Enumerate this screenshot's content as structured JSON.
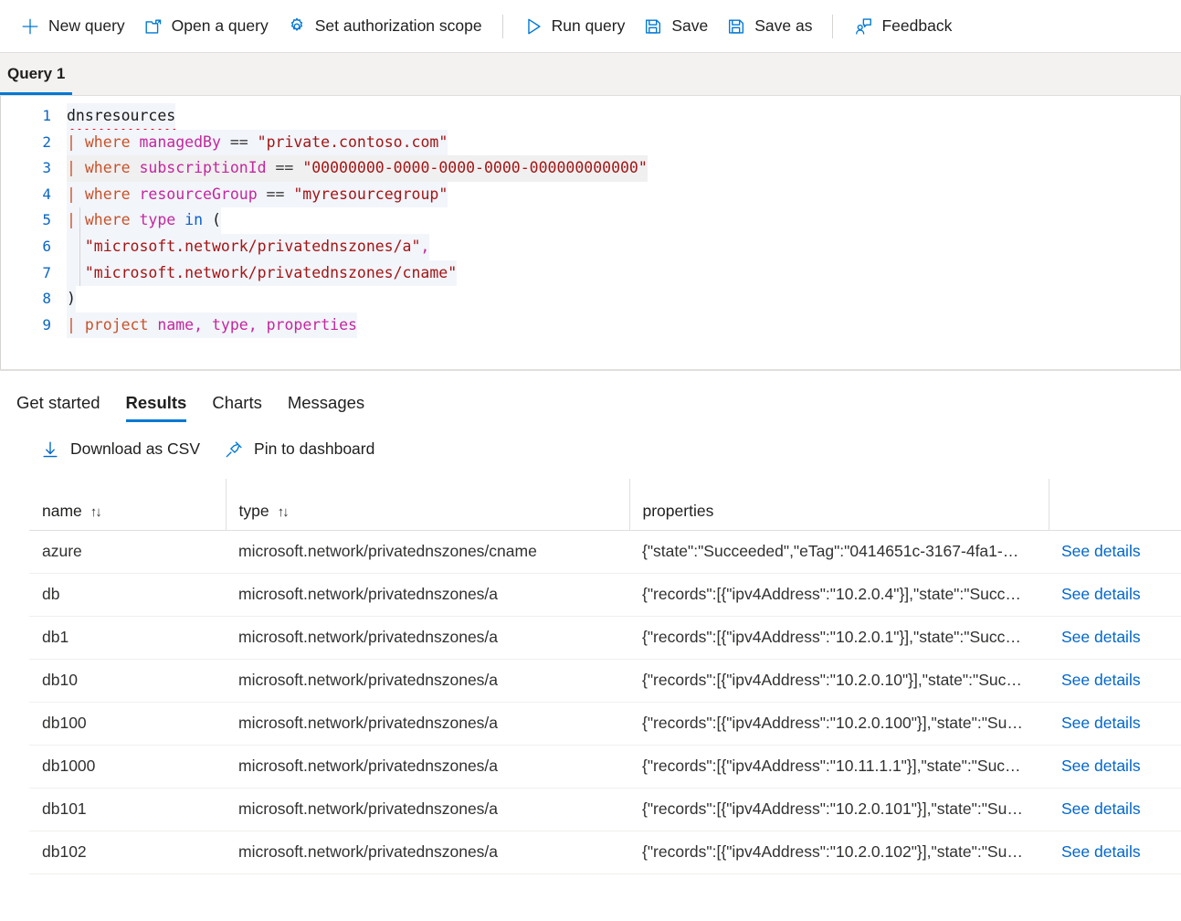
{
  "commandbar": {
    "items": [
      {
        "icon": "plus-icon",
        "label": "New query"
      },
      {
        "icon": "folder-open-icon",
        "label": "Open a query"
      },
      {
        "icon": "gear-icon",
        "label": "Set authorization scope"
      },
      {
        "icon": "play-icon",
        "label": "Run query"
      },
      {
        "icon": "save-icon",
        "label": "Save"
      },
      {
        "icon": "save-as-icon",
        "label": "Save as"
      },
      {
        "icon": "feedback-icon",
        "label": "Feedback"
      }
    ]
  },
  "query_tabs": {
    "tabs": [
      {
        "label": "Query 1",
        "active": true
      }
    ]
  },
  "editor": {
    "current_line": 3,
    "lines": [
      {
        "num": "1",
        "tokens": [
          {
            "t": "dnsresources",
            "c": "t-tbl",
            "squiggle": true
          }
        ]
      },
      {
        "num": "2",
        "tokens": [
          {
            "t": "| ",
            "c": "t-pipe"
          },
          {
            "t": "where ",
            "c": "t-kw"
          },
          {
            "t": "managedBy",
            "c": "t-col"
          },
          {
            "t": " == ",
            "c": "t-eq"
          },
          {
            "t": "\"private.contoso.com\"",
            "c": "t-str"
          }
        ]
      },
      {
        "num": "3",
        "tokens": [
          {
            "t": "| ",
            "c": "t-pipe"
          },
          {
            "t": "where ",
            "c": "t-kw"
          },
          {
            "t": "subscriptionId",
            "c": "t-col"
          },
          {
            "t": " == ",
            "c": "t-eq"
          },
          {
            "t": "\"00000000-0000-0000-0000-000000000000\"",
            "c": "t-str"
          }
        ]
      },
      {
        "num": "4",
        "tokens": [
          {
            "t": "| ",
            "c": "t-pipe"
          },
          {
            "t": "where ",
            "c": "t-kw"
          },
          {
            "t": "resourceGroup",
            "c": "t-col"
          },
          {
            "t": " == ",
            "c": "t-eq"
          },
          {
            "t": "\"myresourcegroup\"",
            "c": "t-str"
          }
        ]
      },
      {
        "num": "5",
        "tokens": [
          {
            "t": "| ",
            "c": "t-pipe"
          },
          {
            "t": "where ",
            "c": "t-kw"
          },
          {
            "t": "type",
            "c": "t-col"
          },
          {
            "t": " ",
            "c": "t-eq"
          },
          {
            "t": "in",
            "c": "t-op-in"
          },
          {
            "t": " (",
            "c": "t-paren"
          }
        ]
      },
      {
        "num": "6",
        "indent": 2,
        "tokens": [
          {
            "t": "  \"microsoft.network/privatednszones/a\"",
            "c": "t-str"
          },
          {
            "t": ",",
            "c": "t-comma"
          }
        ]
      },
      {
        "num": "7",
        "indent": 2,
        "tokens": [
          {
            "t": "  \"microsoft.network/privatednszones/cname\"",
            "c": "t-str"
          }
        ]
      },
      {
        "num": "8",
        "tokens": [
          {
            "t": ")",
            "c": "t-paren"
          }
        ]
      },
      {
        "num": "9",
        "tokens": [
          {
            "t": "| ",
            "c": "t-pipe"
          },
          {
            "t": "project ",
            "c": "t-kw"
          },
          {
            "t": "name",
            "c": "t-col"
          },
          {
            "t": ", ",
            "c": "t-comma"
          },
          {
            "t": "type",
            "c": "t-col"
          },
          {
            "t": ", ",
            "c": "t-comma"
          },
          {
            "t": "properties",
            "c": "t-col"
          }
        ]
      }
    ]
  },
  "results": {
    "tabs": [
      {
        "label": "Get started",
        "active": false
      },
      {
        "label": "Results",
        "active": true
      },
      {
        "label": "Charts",
        "active": false
      },
      {
        "label": "Messages",
        "active": false
      }
    ],
    "actions": [
      {
        "icon": "download-icon",
        "label": "Download as CSV"
      },
      {
        "icon": "pin-icon",
        "label": "Pin to dashboard"
      }
    ],
    "columns": [
      {
        "label": "name",
        "sortable": true
      },
      {
        "label": "type",
        "sortable": true
      },
      {
        "label": "properties",
        "sortable": false
      },
      {
        "label": "",
        "sortable": false
      }
    ],
    "sort_glyph": "↑↓",
    "details_label": "See details",
    "rows": [
      {
        "name": "azure",
        "type": "microsoft.network/privatednszones/cname",
        "properties": "{\"state\":\"Succeeded\",\"eTag\":\"0414651c-3167-4fa1-…"
      },
      {
        "name": "db",
        "type": "microsoft.network/privatednszones/a",
        "properties": "{\"records\":[{\"ipv4Address\":\"10.2.0.4\"}],\"state\":\"Succ…"
      },
      {
        "name": "db1",
        "type": "microsoft.network/privatednszones/a",
        "properties": "{\"records\":[{\"ipv4Address\":\"10.2.0.1\"}],\"state\":\"Succ…"
      },
      {
        "name": "db10",
        "type": "microsoft.network/privatednszones/a",
        "properties": "{\"records\":[{\"ipv4Address\":\"10.2.0.10\"}],\"state\":\"Suc…"
      },
      {
        "name": "db100",
        "type": "microsoft.network/privatednszones/a",
        "properties": "{\"records\":[{\"ipv4Address\":\"10.2.0.100\"}],\"state\":\"Su…"
      },
      {
        "name": "db1000",
        "type": "microsoft.network/privatednszones/a",
        "properties": "{\"records\":[{\"ipv4Address\":\"10.11.1.1\"}],\"state\":\"Suc…"
      },
      {
        "name": "db101",
        "type": "microsoft.network/privatednszones/a",
        "properties": "{\"records\":[{\"ipv4Address\":\"10.2.0.101\"}],\"state\":\"Su…"
      },
      {
        "name": "db102",
        "type": "microsoft.network/privatednszones/a",
        "properties": "{\"records\":[{\"ipv4Address\":\"10.2.0.102\"}],\"state\":\"Su…"
      }
    ]
  },
  "colors": {
    "accent": "#0078d4",
    "link": "#0066cc",
    "tabstrip_bg": "#f3f2f1",
    "border": "#e1dfdd"
  }
}
